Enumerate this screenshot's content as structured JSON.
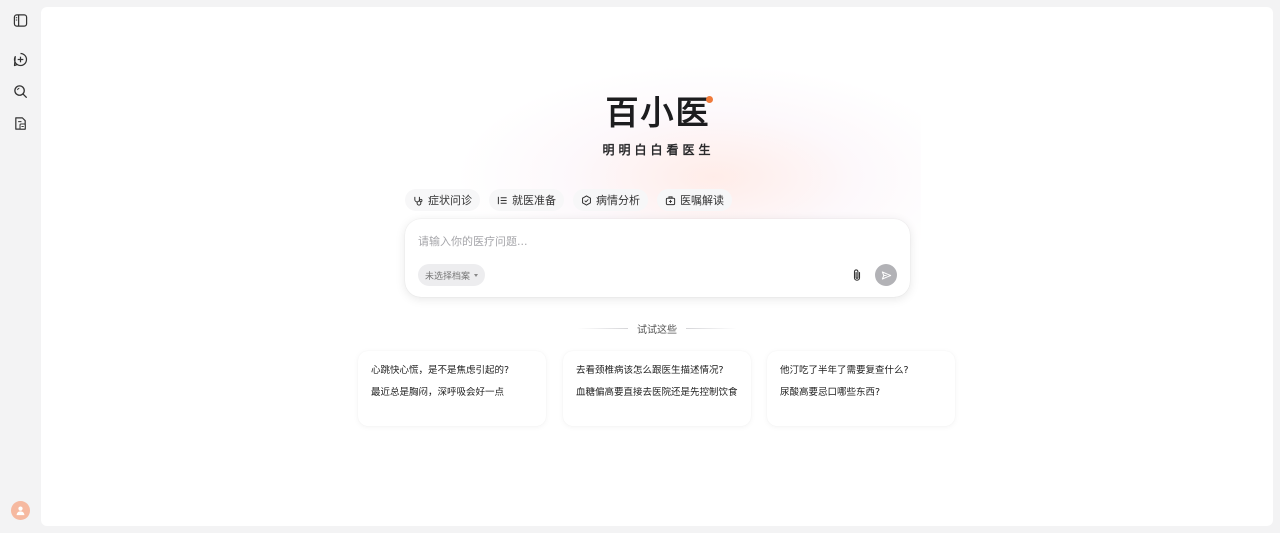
{
  "sidebar": {
    "buttons": [
      {
        "name": "sidebar-toggle",
        "icon": "sidebar-panel-icon"
      },
      {
        "name": "new-chat",
        "icon": "plus-circle-icon"
      },
      {
        "name": "search",
        "icon": "search-icon"
      },
      {
        "name": "records",
        "icon": "document-book-icon"
      }
    ],
    "avatar_icon": "user-icon"
  },
  "brand": {
    "logo": "百小医",
    "slogan": "明明白白看医生",
    "accent_color": "#f07a3a"
  },
  "chips": [
    {
      "label": "症状问诊",
      "icon": "stethoscope-icon"
    },
    {
      "label": "就医准备",
      "icon": "list-icon"
    },
    {
      "label": "病情分析",
      "icon": "hexagon-icon"
    },
    {
      "label": "医嘱解读",
      "icon": "medkit-icon"
    }
  ],
  "input": {
    "placeholder": "请输入你的医疗问题...",
    "value": "",
    "archive_label": "未选择档案",
    "attach_icon": "paperclip-icon",
    "send_icon": "send-icon"
  },
  "try_label": "试试这些",
  "suggestions": [
    {
      "questions": [
        "心跳快心慌，是不是焦虑引起的?",
        "最近总是胸闷，深呼吸会好一点"
      ]
    },
    {
      "questions": [
        "去看颈椎病该怎么跟医生描述情况?",
        "血糖偏高要直接去医院还是先控制饮食"
      ]
    },
    {
      "questions": [
        "他汀吃了半年了需要复查什么?",
        "尿酸高要忌口哪些东西?"
      ]
    }
  ]
}
